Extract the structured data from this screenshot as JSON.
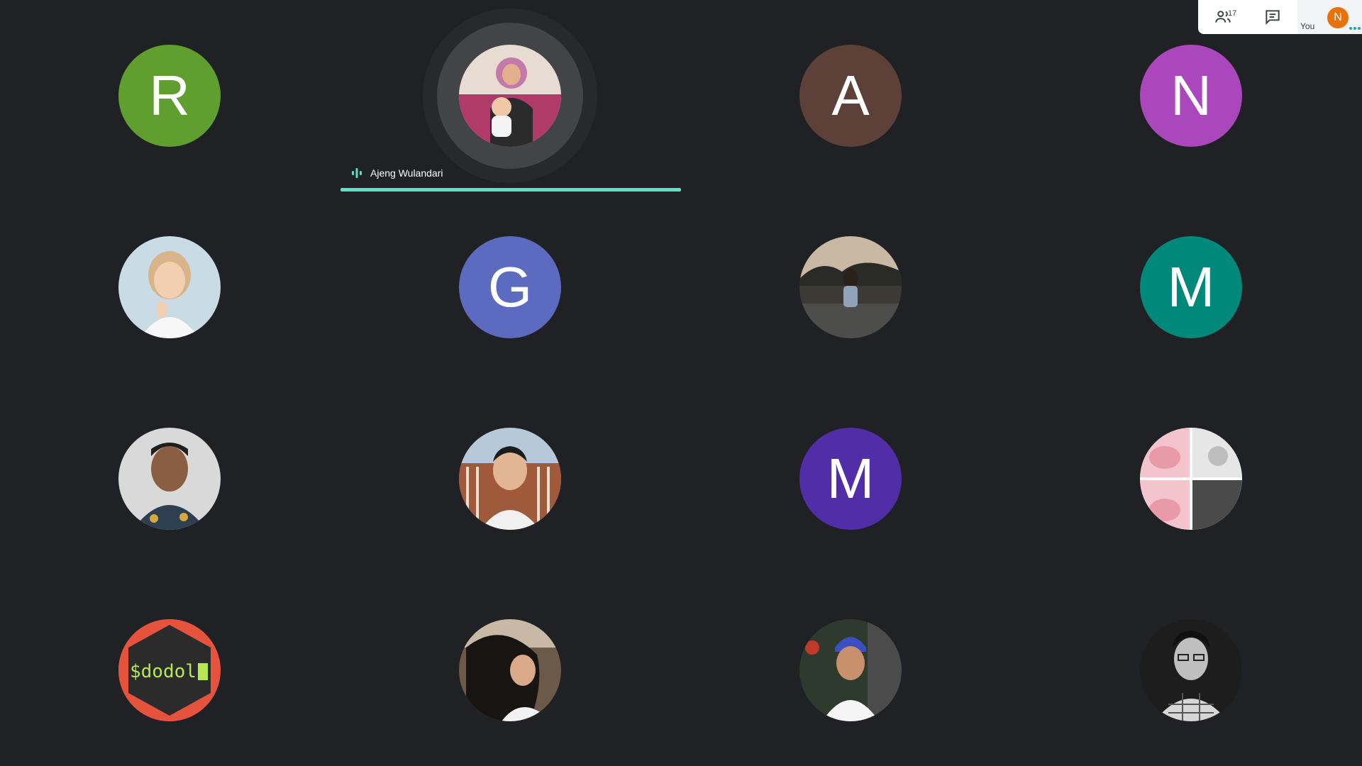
{
  "header": {
    "participant_count": "17",
    "self_label": "You",
    "self_initial": "N",
    "self_color": "#e8710a"
  },
  "participants": [
    {
      "initial": "R",
      "color": "#5f9e2f"
    },
    {
      "name": "Ajeng Wulandari",
      "speaking": true
    },
    {
      "initial": "A",
      "color": "#5d4037"
    },
    {
      "initial": "N",
      "color": "#ab47bc"
    },
    {
      "initial": "",
      "photo": "boy-thumbs-up"
    },
    {
      "initial": "G",
      "color": "#5c6bc0"
    },
    {
      "initial": "",
      "photo": "woman-street-sunset"
    },
    {
      "initial": "M",
      "color": "#00897b"
    },
    {
      "initial": "",
      "photo": "man-batik"
    },
    {
      "initial": "",
      "photo": "young-man-fence"
    },
    {
      "initial": "M",
      "color": "#512da8"
    },
    {
      "initial": "",
      "photo": "comic-brain-meme"
    },
    {
      "initial": "",
      "photo": "dodol-terminal-logo",
      "logo_text": "$dodol"
    },
    {
      "initial": "",
      "photo": "woman-windblown-hair"
    },
    {
      "initial": "",
      "photo": "boy-traditional-headdress"
    },
    {
      "initial": "",
      "photo": "man-glasses-bw"
    }
  ]
}
